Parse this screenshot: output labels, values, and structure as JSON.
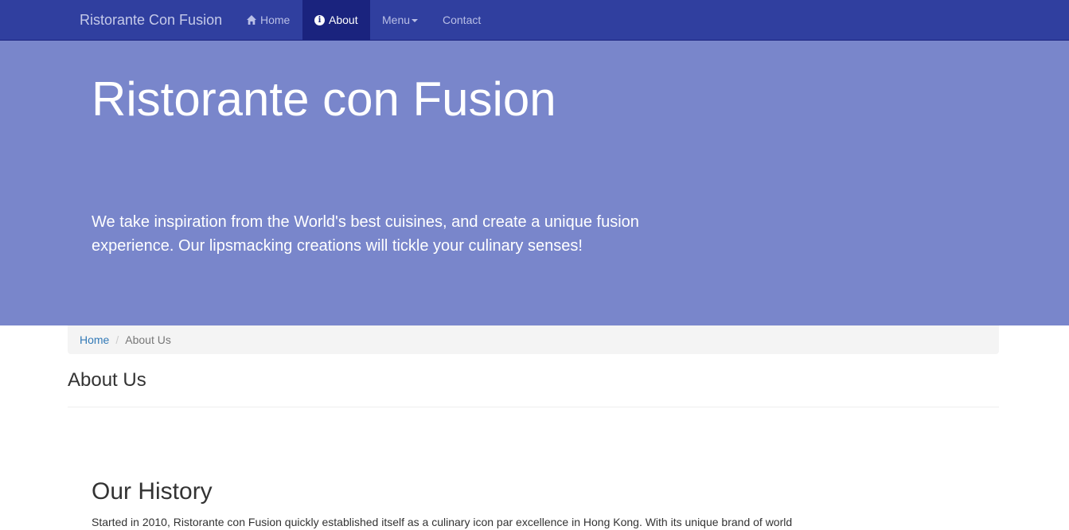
{
  "navbar": {
    "brand": "Ristorante Con Fusion",
    "items": [
      {
        "label": "Home",
        "icon": "home-icon",
        "active": false
      },
      {
        "label": "About",
        "icon": "info-icon",
        "active": true
      },
      {
        "label": "Menu",
        "icon": "caret-down-icon",
        "active": false
      },
      {
        "label": "Contact",
        "active": false
      }
    ]
  },
  "hero": {
    "title": "Ristorante con Fusion",
    "text": "We take inspiration from the World's best cuisines, and create a unique fusion experience. Our lipsmacking creations will tickle your culinary senses!"
  },
  "breadcrumb": {
    "items": [
      {
        "label": "Home",
        "link": true
      },
      {
        "label": "About Us",
        "link": false
      }
    ],
    "separator": "/"
  },
  "page": {
    "heading": "About Us"
  },
  "history": {
    "heading": "Our History",
    "text": "Started in 2010, Ristorante con Fusion quickly established itself as a culinary icon par excellence in Hong Kong. With its unique brand of world"
  },
  "colors": {
    "navbar": "#303f9f",
    "navbar_active": "#1a237e",
    "hero": "#7986cb",
    "link": "#337ab7",
    "breadcrumb_bg": "#f4f4f4"
  }
}
